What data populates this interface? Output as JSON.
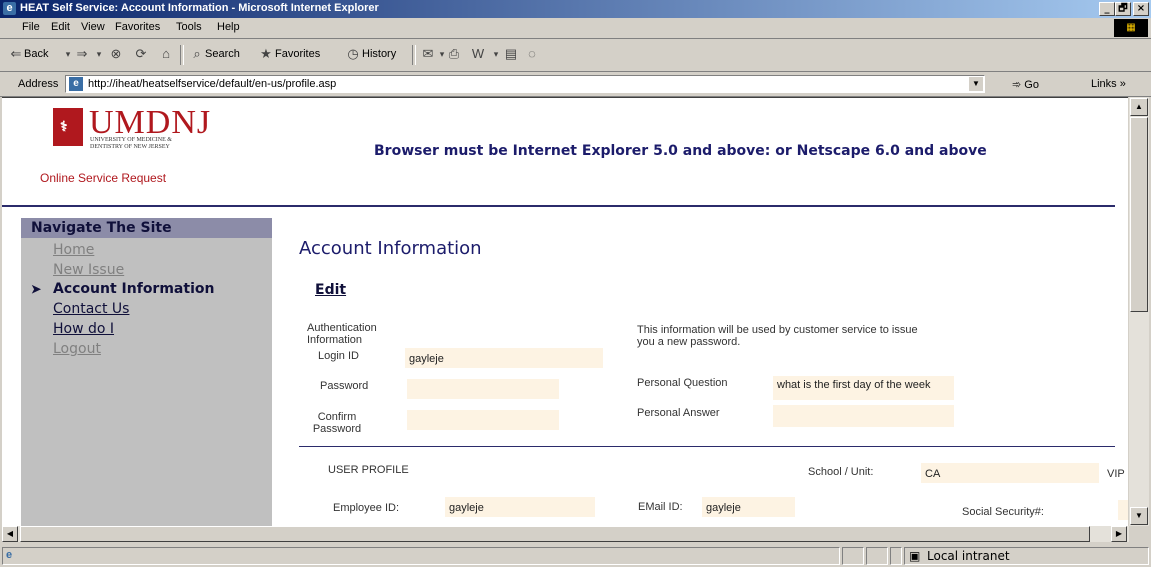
{
  "window": {
    "title": "HEAT Self Service: Account Information - Microsoft Internet Explorer",
    "controls": [
      "_",
      "🗗",
      "×"
    ]
  },
  "menu": [
    "File",
    "Edit",
    "View",
    "Favorites",
    "Tools",
    "Help"
  ],
  "toolbar": {
    "back": "Back",
    "search": "Search",
    "favorites": "Favorites",
    "history": "History"
  },
  "address": {
    "label": "Address",
    "url": "http://iheat/heatselfservice/default/en-us/profile.asp",
    "go": "Go",
    "links": "Links »"
  },
  "header": {
    "logo_name": "UMDNJ",
    "logo_sub": "University of Medicine & Dentistry of New Jersey",
    "service": "Online Service Request",
    "browser_msg": "Browser must be Internet Explorer 5.0 and above: or Netscape 6.0 and above"
  },
  "nav": {
    "title": "Navigate The Site",
    "items": [
      "Home",
      "New Issue",
      "Account Information",
      "Contact Us",
      "How do I",
      "Logout"
    ],
    "active": "Account Information"
  },
  "main": {
    "title": "Account Information",
    "edit": "Edit",
    "auth_label": "Authentication Information",
    "info_text": "This information will be used by customer service to issue you a new password.",
    "login_label": "Login ID",
    "login_value": "gayleje",
    "password_label": "Password",
    "password_value": "",
    "confirm_label": "Confirm Password",
    "confirm_value": "",
    "question_label": "Personal Question",
    "question_value": "what is the first day of the week",
    "answer_label": "Personal Answer",
    "answer_value": "",
    "profile_label": "USER PROFILE",
    "school_label": "School / Unit:",
    "school_value": "CA",
    "vip_label": "VIP",
    "employee_label": "Employee ID:",
    "employee_value": "gayleje",
    "email_label": "EMail ID:",
    "email_value": "gayleje",
    "ssn_label": "Social Security#:"
  },
  "status": {
    "zone": "Local intranet"
  }
}
